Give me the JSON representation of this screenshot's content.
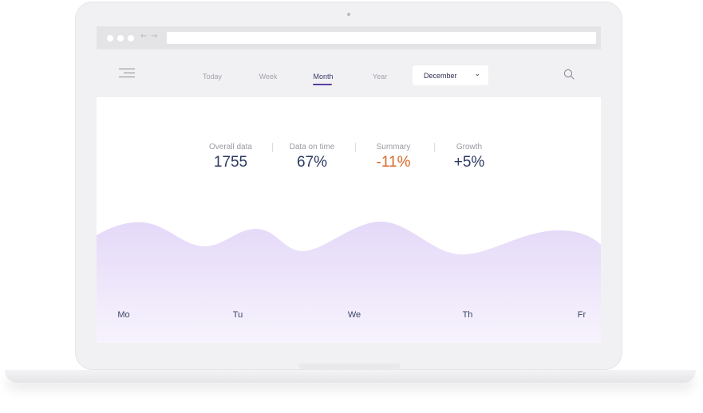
{
  "colors": {
    "accent": "#5b3fa0",
    "value_text": "#2c3a62",
    "negative": "#d9692a",
    "wave_top": "#e4d9f8",
    "wave_bottom": "#f7f3fd"
  },
  "browser": {
    "controls": [
      "close-dot",
      "minimize-dot",
      "maximize-dot"
    ],
    "back_icon": "←",
    "forward_icon": "→",
    "url": ""
  },
  "header": {
    "menu_icon": "hamburger-icon",
    "tabs": [
      {
        "label": "Today",
        "active": false
      },
      {
        "label": "Week",
        "active": false
      },
      {
        "label": "Month",
        "active": true
      },
      {
        "label": "Year",
        "active": false
      }
    ],
    "month_select": {
      "value": "December",
      "chevron": "⌄"
    },
    "search_icon": "search-icon"
  },
  "stats": [
    {
      "label": "Overall data",
      "value": "1755"
    },
    {
      "label": "Data on time",
      "value": "67%"
    },
    {
      "label": "Summary",
      "value": "-11%"
    },
    {
      "label": "Growth",
      "value": "+5%"
    }
  ],
  "chart_data": {
    "type": "area",
    "categories": [
      "Mo",
      "Tu",
      "We",
      "Th",
      "Fr"
    ],
    "grid": false,
    "legend": "none"
  }
}
